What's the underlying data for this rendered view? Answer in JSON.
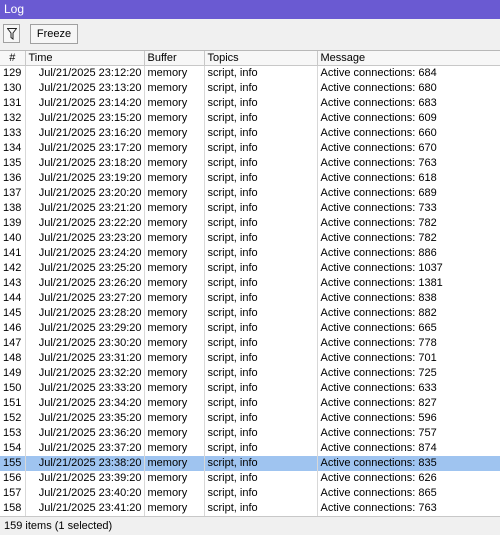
{
  "window": {
    "title": "Log"
  },
  "toolbar": {
    "freeze_label": "Freeze"
  },
  "columns": {
    "num": "#",
    "time": "Time",
    "buffer": "Buffer",
    "topics": "Topics",
    "message": "Message"
  },
  "rows": [
    {
      "num": "129",
      "time": "Jul/21/2025 23:12:20",
      "buffer": "memory",
      "topics": "script, info",
      "message": "Active connections: 684"
    },
    {
      "num": "130",
      "time": "Jul/21/2025 23:13:20",
      "buffer": "memory",
      "topics": "script, info",
      "message": "Active connections: 680"
    },
    {
      "num": "131",
      "time": "Jul/21/2025 23:14:20",
      "buffer": "memory",
      "topics": "script, info",
      "message": "Active connections: 683"
    },
    {
      "num": "132",
      "time": "Jul/21/2025 23:15:20",
      "buffer": "memory",
      "topics": "script, info",
      "message": "Active connections: 609"
    },
    {
      "num": "133",
      "time": "Jul/21/2025 23:16:20",
      "buffer": "memory",
      "topics": "script, info",
      "message": "Active connections: 660"
    },
    {
      "num": "134",
      "time": "Jul/21/2025 23:17:20",
      "buffer": "memory",
      "topics": "script, info",
      "message": "Active connections: 670"
    },
    {
      "num": "135",
      "time": "Jul/21/2025 23:18:20",
      "buffer": "memory",
      "topics": "script, info",
      "message": "Active connections: 763"
    },
    {
      "num": "136",
      "time": "Jul/21/2025 23:19:20",
      "buffer": "memory",
      "topics": "script, info",
      "message": "Active connections: 618"
    },
    {
      "num": "137",
      "time": "Jul/21/2025 23:20:20",
      "buffer": "memory",
      "topics": "script, info",
      "message": "Active connections: 689"
    },
    {
      "num": "138",
      "time": "Jul/21/2025 23:21:20",
      "buffer": "memory",
      "topics": "script, info",
      "message": "Active connections: 733"
    },
    {
      "num": "139",
      "time": "Jul/21/2025 23:22:20",
      "buffer": "memory",
      "topics": "script, info",
      "message": "Active connections: 782"
    },
    {
      "num": "140",
      "time": "Jul/21/2025 23:23:20",
      "buffer": "memory",
      "topics": "script, info",
      "message": "Active connections: 782"
    },
    {
      "num": "141",
      "time": "Jul/21/2025 23:24:20",
      "buffer": "memory",
      "topics": "script, info",
      "message": "Active connections: 886"
    },
    {
      "num": "142",
      "time": "Jul/21/2025 23:25:20",
      "buffer": "memory",
      "topics": "script, info",
      "message": "Active connections: 1037"
    },
    {
      "num": "143",
      "time": "Jul/21/2025 23:26:20",
      "buffer": "memory",
      "topics": "script, info",
      "message": "Active connections: 1381"
    },
    {
      "num": "144",
      "time": "Jul/21/2025 23:27:20",
      "buffer": "memory",
      "topics": "script, info",
      "message": "Active connections: 838"
    },
    {
      "num": "145",
      "time": "Jul/21/2025 23:28:20",
      "buffer": "memory",
      "topics": "script, info",
      "message": "Active connections: 882"
    },
    {
      "num": "146",
      "time": "Jul/21/2025 23:29:20",
      "buffer": "memory",
      "topics": "script, info",
      "message": "Active connections: 665"
    },
    {
      "num": "147",
      "time": "Jul/21/2025 23:30:20",
      "buffer": "memory",
      "topics": "script, info",
      "message": "Active connections: 778"
    },
    {
      "num": "148",
      "time": "Jul/21/2025 23:31:20",
      "buffer": "memory",
      "topics": "script, info",
      "message": "Active connections: 701"
    },
    {
      "num": "149",
      "time": "Jul/21/2025 23:32:20",
      "buffer": "memory",
      "topics": "script, info",
      "message": "Active connections: 725"
    },
    {
      "num": "150",
      "time": "Jul/21/2025 23:33:20",
      "buffer": "memory",
      "topics": "script, info",
      "message": "Active connections: 633"
    },
    {
      "num": "151",
      "time": "Jul/21/2025 23:34:20",
      "buffer": "memory",
      "topics": "script, info",
      "message": "Active connections: 827"
    },
    {
      "num": "152",
      "time": "Jul/21/2025 23:35:20",
      "buffer": "memory",
      "topics": "script, info",
      "message": "Active connections: 596"
    },
    {
      "num": "153",
      "time": "Jul/21/2025 23:36:20",
      "buffer": "memory",
      "topics": "script, info",
      "message": "Active connections: 757"
    },
    {
      "num": "154",
      "time": "Jul/21/2025 23:37:20",
      "buffer": "memory",
      "topics": "script, info",
      "message": "Active connections: 874"
    },
    {
      "num": "155",
      "time": "Jul/21/2025 23:38:20",
      "buffer": "memory",
      "topics": "script, info",
      "message": "Active connections: 835",
      "selected": true
    },
    {
      "num": "156",
      "time": "Jul/21/2025 23:39:20",
      "buffer": "memory",
      "topics": "script, info",
      "message": "Active connections: 626"
    },
    {
      "num": "157",
      "time": "Jul/21/2025 23:40:20",
      "buffer": "memory",
      "topics": "script, info",
      "message": "Active connections: 865"
    },
    {
      "num": "158",
      "time": "Jul/21/2025 23:41:20",
      "buffer": "memory",
      "topics": "script, info",
      "message": "Active connections: 763"
    }
  ],
  "status": {
    "text": "159 items (1 selected)"
  },
  "colors": {
    "titlebar": "#6a5ad2",
    "selected_row": "#9fc4f0"
  },
  "icons": {
    "filter": "funnel-icon"
  }
}
